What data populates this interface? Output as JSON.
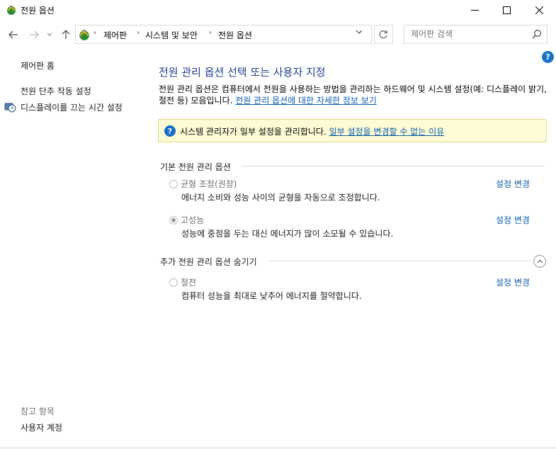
{
  "window": {
    "title": "전원 옵션"
  },
  "nav": {
    "breadcrumbs": [
      "제어판",
      "시스템 및 보안",
      "전원 옵션"
    ],
    "search_placeholder": "제어판 검색"
  },
  "sidebar": {
    "home": "제어판 홈",
    "power_buttons": "전원 단추 작동 설정",
    "display_off": "디스플레이를 끄는 시간 설정",
    "see_also": "참고 항목",
    "user_accounts": "사용자 계정"
  },
  "main": {
    "title": "전원 관리 옵션 선택 또는 사용자 지정",
    "description": "전원 관리 옵션은 컴퓨터에서 전원을 사용하는 방법을 관리하는 하드웨어 및 시스템 설정(예: 디스플레이 밝기, 절전 등) 모음입니다. ",
    "description_link": "전원 관리 옵션에 대한 자세한 정보 보기",
    "info_text": "시스템 관리자가 일부 설정을 관리합니다. ",
    "info_link": "일부 설정을 변경할 수 없는 이유",
    "basic_header": "기본 전원 관리 옵션",
    "hidden_header": "추가 전원 관리 옵션 숨기기",
    "plans": [
      {
        "name": "균형 조정(권장)",
        "desc": "에너지 소비와 성능 사이의 균형을 자동으로 조정합니다.",
        "change": "설정 변경",
        "selected": false
      },
      {
        "name": "고성능",
        "desc": "성능에 중점을 두는 대신 에너지가 많이 소모될 수 있습니다.",
        "change": "설정 변경",
        "selected": true
      },
      {
        "name": "절전",
        "desc": "컴퓨터 성능을 최대로 낮추어 에너지를 절약합니다.",
        "change": "설정 변경",
        "selected": false
      }
    ]
  },
  "icons": {
    "app": "power-options-icon",
    "back": "back-arrow-icon",
    "forward": "forward-arrow-icon",
    "up": "up-arrow-icon",
    "refresh": "refresh-icon",
    "search": "search-icon",
    "help": "help-icon",
    "info": "info-icon",
    "shield": "shield-clock-icon"
  },
  "colors": {
    "link": "#0b5cad",
    "title": "#1e3e8a",
    "info_bg": "#fdfbd5"
  }
}
